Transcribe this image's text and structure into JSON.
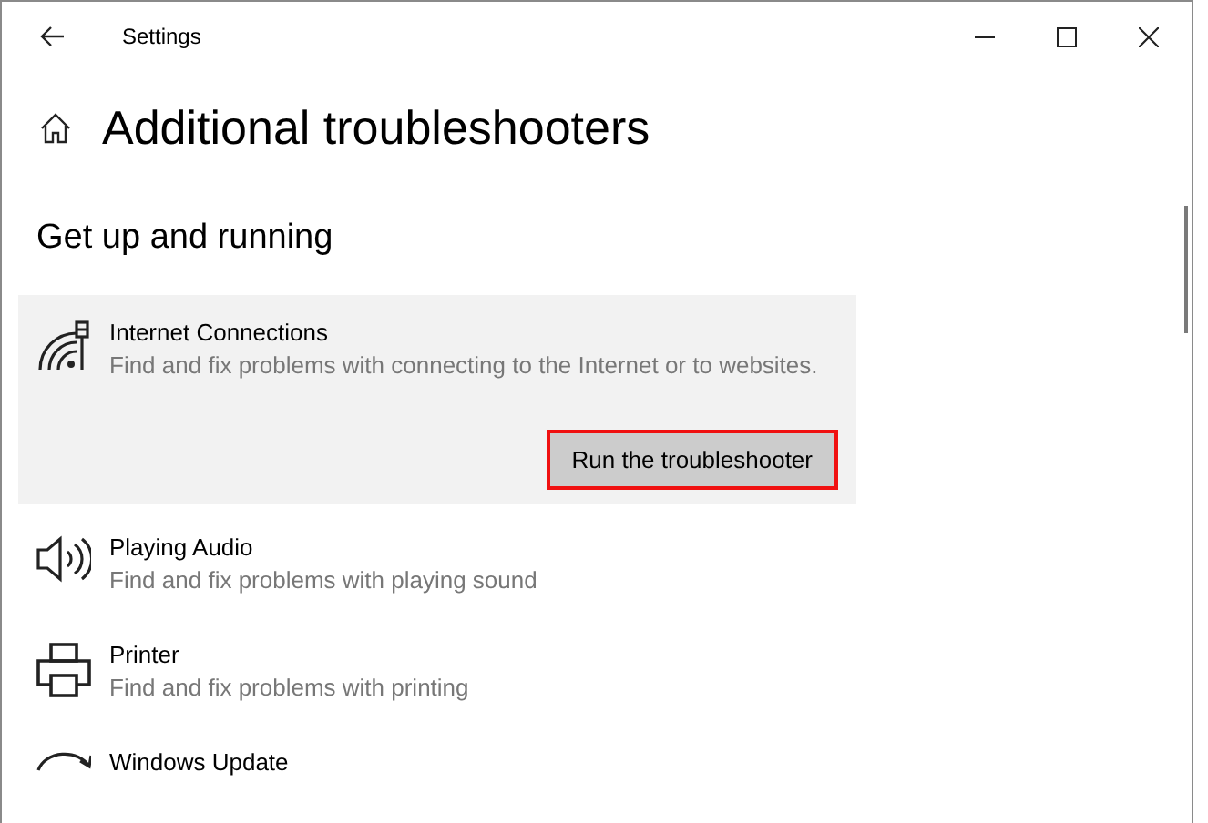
{
  "window": {
    "title": "Settings"
  },
  "page": {
    "title": "Additional troubleshooters",
    "section": "Get up and running"
  },
  "items": [
    {
      "kind": "network",
      "title": "Internet Connections",
      "description": "Find and fix problems with connecting to the Internet or to websites.",
      "expanded": true,
      "button": "Run the troubleshooter"
    },
    {
      "kind": "audio",
      "title": "Playing Audio",
      "description": "Find and fix problems with playing sound",
      "expanded": false
    },
    {
      "kind": "printer",
      "title": "Printer",
      "description": "Find and fix problems with printing",
      "expanded": false
    },
    {
      "kind": "update",
      "title": "Windows Update",
      "expanded": false
    }
  ]
}
